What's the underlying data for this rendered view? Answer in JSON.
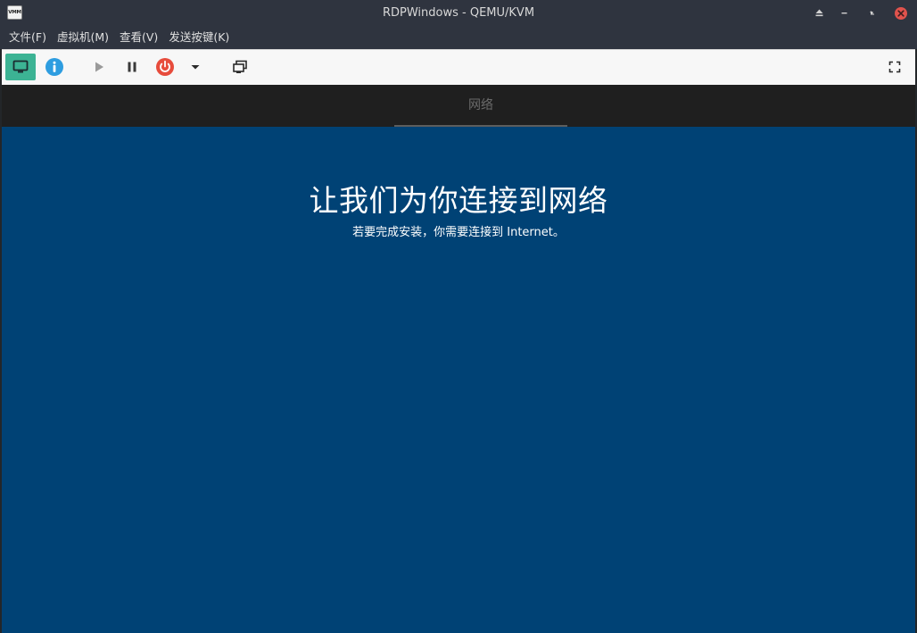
{
  "window": {
    "title": "RDPWindows - QEMU/KVM",
    "logo_text": "VMM"
  },
  "menu": {
    "items": [
      {
        "label": "文件(F)"
      },
      {
        "label": "虚拟机(M)"
      },
      {
        "label": "查看(V)"
      },
      {
        "label": "发送按键(K)"
      }
    ]
  },
  "toolbar": {
    "buttons": [
      {
        "name": "console-view-button",
        "icon": "monitor-icon",
        "active": true
      },
      {
        "name": "details-view-button",
        "icon": "info-icon"
      },
      {
        "name": "run-button",
        "icon": "play-icon"
      },
      {
        "name": "pause-button",
        "icon": "pause-icon"
      },
      {
        "name": "shutdown-button",
        "icon": "power-icon"
      },
      {
        "name": "shutdown-menu-button",
        "icon": "caret-down-icon"
      },
      {
        "name": "snapshots-button",
        "icon": "snapshot-icon"
      },
      {
        "name": "fullscreen-button",
        "icon": "fullscreen-icon"
      }
    ]
  },
  "colors": {
    "accent_active": "#3cb394",
    "info_blue": "#2e9de0",
    "power_red": "#e74c3c",
    "vm_background": "#004275"
  },
  "guest": {
    "tab_label": "网络",
    "heading": "让我们为你连接到网络",
    "subtitle": "若要完成安装，你需要连接到 Internet。"
  }
}
